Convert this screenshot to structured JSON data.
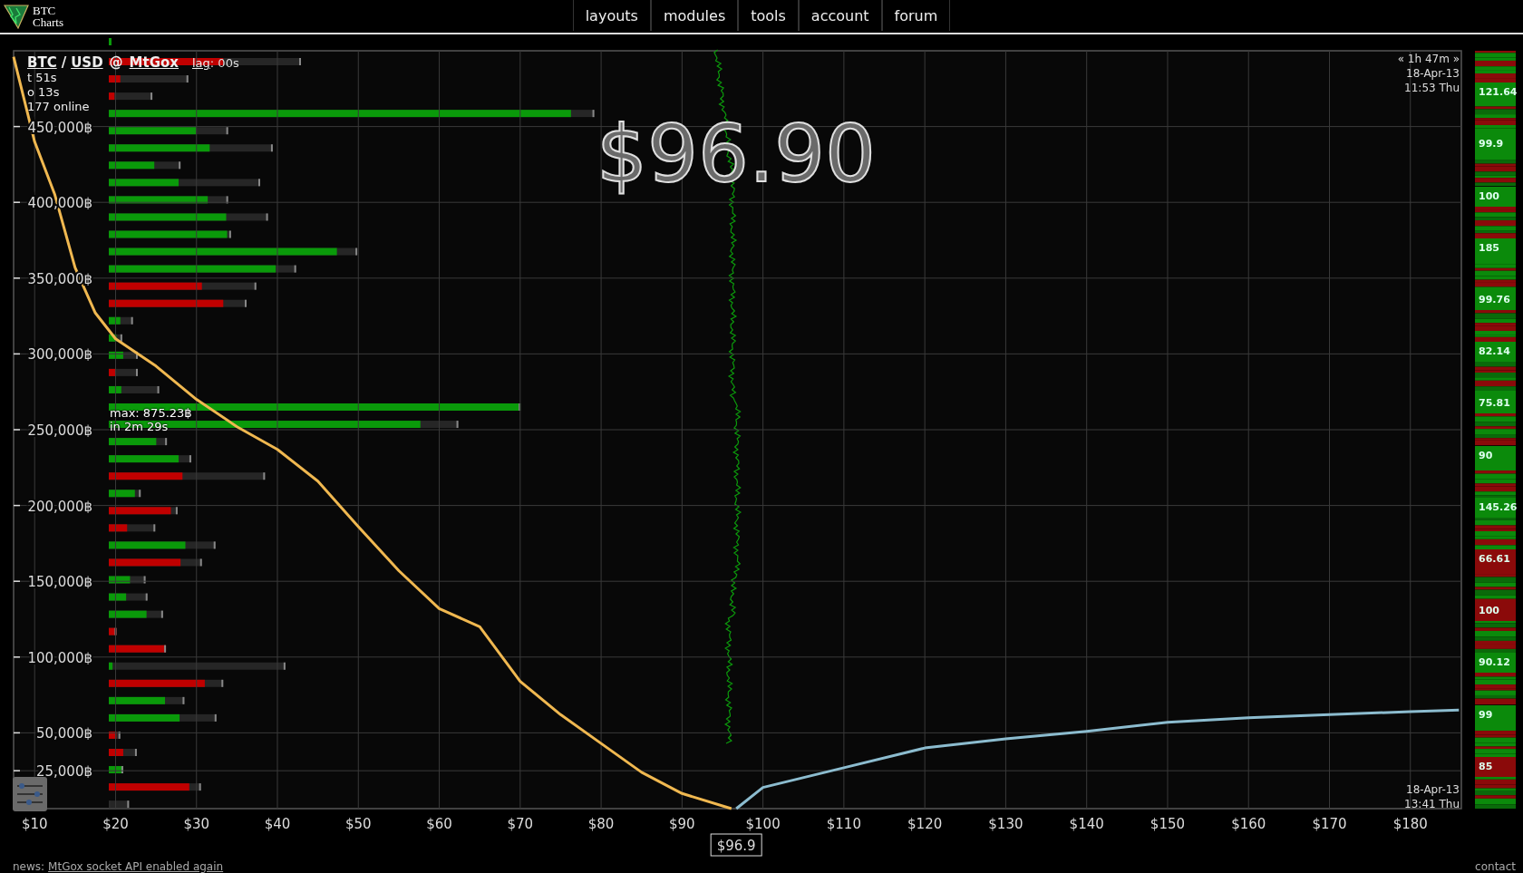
{
  "header": {
    "logo_lines": [
      "BTC",
      "Charts"
    ],
    "menu": [
      {
        "label": "layouts"
      },
      {
        "label": "modules"
      },
      {
        "label": "tools"
      },
      {
        "label": "account"
      },
      {
        "label": "forum"
      }
    ]
  },
  "market": {
    "base": "BTC",
    "separator": "/",
    "quote": "USD",
    "at": "@",
    "exchange": "MtGox",
    "lag_label": "lag",
    "lag_value": ": 00s",
    "stats": [
      "t 51s",
      "o 13s",
      "177 online"
    ]
  },
  "price": "$96.90",
  "time_range": {
    "span": "« 1h 47m »",
    "start_date": "18-Apr-13",
    "start_time": "11:53 Thu",
    "end_date": "18-Apr-13",
    "end_time": "13:41 Thu"
  },
  "max_tooltip": [
    "max: 875.23฿",
    "in 2m 29s"
  ],
  "depth_chart": {
    "price_marker": "$96.9",
    "chart_data": {
      "type": "line",
      "x": [
        7.4,
        10,
        12.5,
        15,
        17.5,
        20,
        25,
        30,
        35,
        40,
        45,
        50,
        55,
        60,
        65,
        70,
        75,
        80,
        85,
        90,
        96.1,
        96.7,
        100,
        110,
        120,
        130,
        140,
        150,
        160,
        170,
        180,
        186
      ],
      "series": [
        {
          "color": "#f0b850",
          "values": [
            496000,
            440000,
            405000,
            357000,
            327000,
            310000,
            292000,
            270000,
            252000,
            237000,
            216000,
            186000,
            157000,
            132000,
            120000,
            84000,
            62000,
            43000,
            24000,
            10000,
            0,
            null,
            null,
            null,
            null,
            null,
            null,
            null,
            null,
            null,
            null,
            null
          ]
        },
        {
          "color": "#8cbccf",
          "values": [
            null,
            null,
            null,
            null,
            null,
            null,
            null,
            null,
            null,
            null,
            null,
            null,
            null,
            null,
            null,
            null,
            null,
            null,
            null,
            null,
            null,
            0,
            14000,
            27000,
            40000,
            46000,
            51000,
            57000,
            60000,
            62000,
            64000,
            65000
          ]
        }
      ],
      "grid": true,
      "xlim": [
        7.4,
        186.3
      ],
      "ylim": [
        0,
        500000
      ],
      "xticks": [
        {
          "value": 10,
          "label": "$10"
        },
        {
          "value": 20,
          "label": "$20"
        },
        {
          "value": 30,
          "label": "$30"
        },
        {
          "value": 40,
          "label": "$40"
        },
        {
          "value": 50,
          "label": "$50"
        },
        {
          "value": 60,
          "label": "$60"
        },
        {
          "value": 70,
          "label": "$70"
        },
        {
          "value": 80,
          "label": "$80"
        },
        {
          "value": 90,
          "label": "$90"
        },
        {
          "value": 100,
          "label": "$100"
        },
        {
          "value": 110,
          "label": "$110"
        },
        {
          "value": 120,
          "label": "$120"
        },
        {
          "value": 130,
          "label": "$130"
        },
        {
          "value": 140,
          "label": "$140"
        },
        {
          "value": 150,
          "label": "$150"
        },
        {
          "value": 160,
          "label": "$160"
        },
        {
          "value": 170,
          "label": "$170"
        },
        {
          "value": 180,
          "label": "$180"
        }
      ],
      "yticks": [
        {
          "value": 25000,
          "label": "25,000฿"
        },
        {
          "value": 50000,
          "label": "50,000฿"
        },
        {
          "value": 100000,
          "label": "100,000฿"
        },
        {
          "value": 150000,
          "label": "150,000฿"
        },
        {
          "value": 200000,
          "label": "200,000฿"
        },
        {
          "value": 250000,
          "label": "250,000฿"
        },
        {
          "value": 300000,
          "label": "300,000฿"
        },
        {
          "value": 350000,
          "label": "350,000฿"
        },
        {
          "value": 400000,
          "label": "400,000฿"
        },
        {
          "value": 450000,
          "label": "450,000฿"
        }
      ]
    }
  },
  "trades": [
    {
      "amount": "121.64",
      "color": "#0b8a0b"
    },
    {
      "amount": "99.9",
      "color": "#0b8a0b"
    },
    {
      "amount": "100",
      "color": "#0b8a0b"
    },
    {
      "amount": "185",
      "color": "#0b8a0b"
    },
    {
      "amount": "99.76",
      "color": "#0b8a0b"
    },
    {
      "amount": "82.14",
      "color": "#0b8a0b"
    },
    {
      "amount": "75.81",
      "color": "#0b8a0b"
    },
    {
      "amount": "90",
      "color": "#0b8a0b"
    },
    {
      "amount": "145.26",
      "color": "#0b8a0b"
    },
    {
      "amount": "66.61",
      "color": "#8b0a0a"
    },
    {
      "amount": "100",
      "color": "#8b0a0a"
    },
    {
      "amount": "90.12",
      "color": "#0b8a0b"
    },
    {
      "amount": "99",
      "color": "#0b8a0b"
    },
    {
      "amount": "85",
      "color": "#8b0a0a"
    }
  ],
  "news": {
    "label": "news:",
    "link": "MtGox socket API enabled again"
  },
  "footer_link": "contact"
}
